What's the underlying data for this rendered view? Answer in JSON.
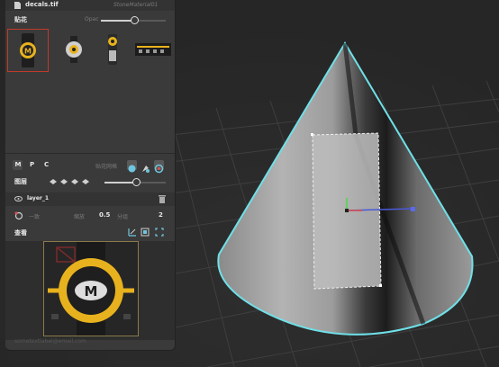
{
  "top": {
    "filename": "decals.tif",
    "material": "StoneMaterial01"
  },
  "decal_section": {
    "title": "贴花",
    "opacity_label": "Opac"
  },
  "thumbnails": [
    {
      "name": "decal-thumbnail-m-badge",
      "selected": true
    },
    {
      "name": "decal-thumbnail-gear-badge",
      "selected": false
    },
    {
      "name": "decal-thumbnail-robot-badge",
      "selected": false
    },
    {
      "name": "decal-thumbnail-strip",
      "selected": false
    }
  ],
  "mode_bar": {
    "m": "M",
    "p": "P",
    "c": "C",
    "label": "贴花网格"
  },
  "layers_section": {
    "title": "图层",
    "layer_name": "layer_1"
  },
  "params": {
    "label1": "一致",
    "label2": "缩放",
    "value1": "0.5",
    "label3": "分组",
    "value2": "2"
  },
  "view_section": {
    "title": "查看"
  },
  "footer": {
    "text": "sometextlabel@email.com"
  },
  "colors": {
    "accent": "#6fe0e8",
    "selection": "#c0392b",
    "decal_yellow": "#e8b21e"
  },
  "icons": [
    "file-icon",
    "eye-icon",
    "layers-icon",
    "rotate-icon",
    "sphere-icon",
    "grid-icon",
    "frame-icon"
  ]
}
